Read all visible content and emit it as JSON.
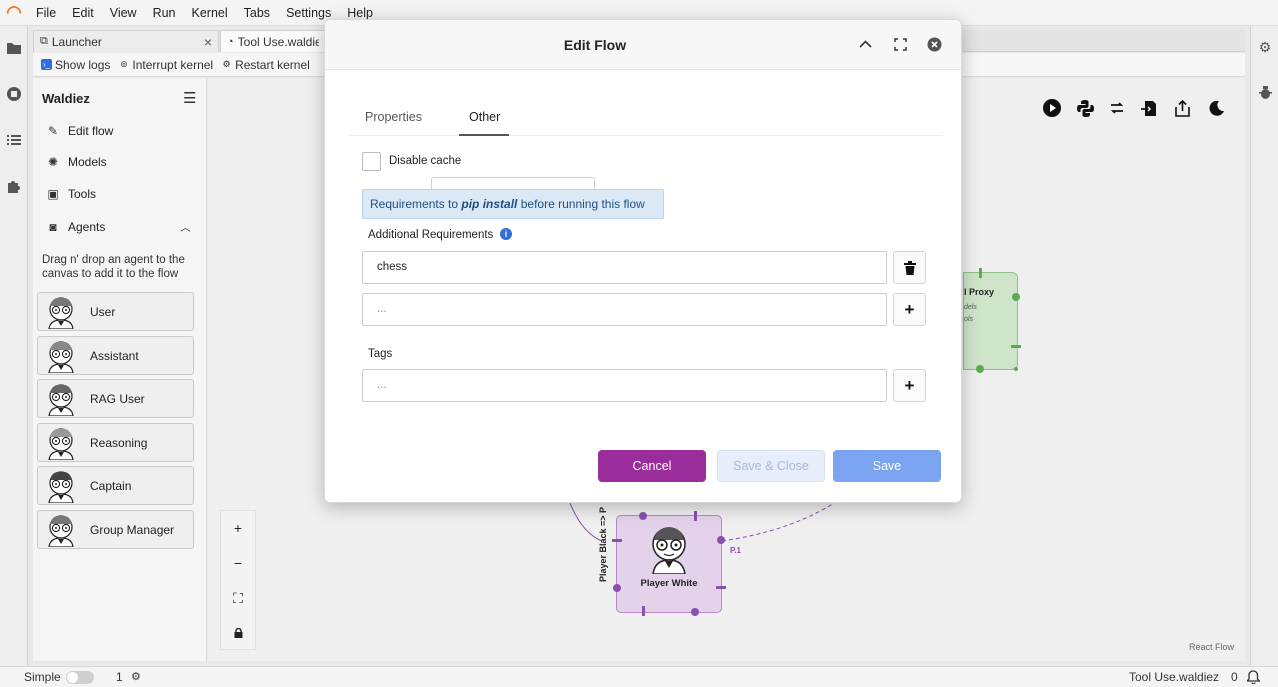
{
  "menubar": {
    "items": [
      "File",
      "Edit",
      "View",
      "Run",
      "Kernel",
      "Tabs",
      "Settings",
      "Help"
    ]
  },
  "tabs": [
    {
      "label": "Launcher"
    },
    {
      "label": "Tool Use.waldie"
    }
  ],
  "toolbar": {
    "show_logs": "Show logs",
    "interrupt": "Interrupt kernel",
    "restart": "Restart kernel"
  },
  "sidebar": {
    "title": "Waldiez",
    "links": {
      "edit_flow": "Edit flow",
      "models": "Models",
      "tools": "Tools",
      "agents": "Agents"
    },
    "hint": "Drag n' drop an agent to the canvas to add it to the flow",
    "agents": [
      "User",
      "Assistant",
      "RAG User",
      "Reasoning",
      "Captain",
      "Group Manager"
    ]
  },
  "canvas": {
    "proxy_node": {
      "name": "l Proxy",
      "sub1": "dels",
      "sub2": "ols"
    },
    "white_node": {
      "name": "Player White"
    },
    "edge_p1": "P.1",
    "edge_black": "Player Black => P",
    "attribution": "React Flow"
  },
  "modal": {
    "title": "Edit Flow",
    "tabs": [
      "Properties",
      "Other"
    ],
    "active_tab": "Other",
    "disable_cache_label": "Disable cache",
    "tooltip_pre": "Requirements to ",
    "tooltip_em": "pip install",
    "tooltip_post": " before running this flow",
    "additional_requirements_label": "Additional Requirements",
    "requirement_value": "chess",
    "requirement_placeholder": "...",
    "tags_label": "Tags",
    "tags_placeholder": "...",
    "buttons": {
      "cancel": "Cancel",
      "save_close": "Save & Close",
      "save": "Save"
    }
  },
  "statusbar": {
    "mode": "Simple",
    "count": "1",
    "filename": "Tool Use.waldiez",
    "notifications": "0"
  },
  "colors": {
    "cancel": "#9b2c9b",
    "save": "#7aa4f0",
    "proxy_node": "#cfe5c9",
    "white_node": "#e3d2ea"
  }
}
